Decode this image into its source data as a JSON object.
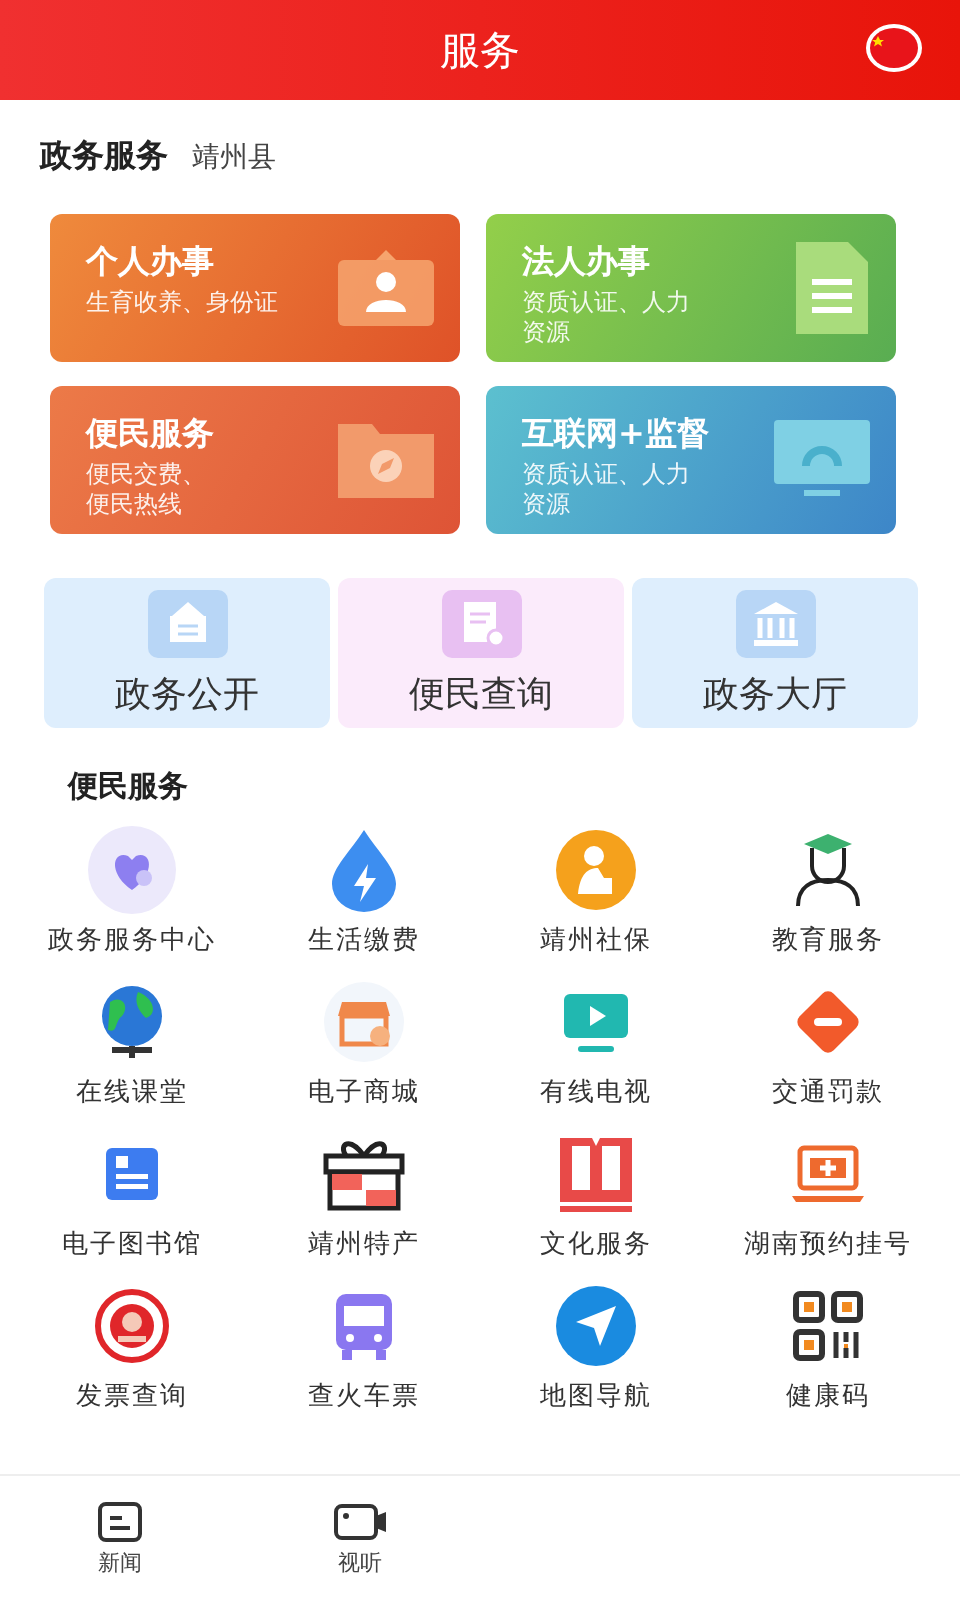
{
  "header": {
    "title": "服务"
  },
  "region": {
    "title": "政务服务",
    "county": "靖州县"
  },
  "cards": [
    {
      "kind": "person",
      "title": "个人办事",
      "subtitle": "生育收养、身份证"
    },
    {
      "kind": "legal",
      "title": "法人办事",
      "subtitle": "资质认证、人力资源"
    },
    {
      "kind": "service",
      "title": "便民服务",
      "subtitle": "便民交费、便民热线"
    },
    {
      "kind": "internet",
      "title": "互联网+监督",
      "subtitle": "资质认证、人力资源"
    }
  ],
  "tiles": [
    {
      "kind": "open",
      "label": "政务公开"
    },
    {
      "kind": "query",
      "label": "便民查询"
    },
    {
      "kind": "hall",
      "label": "政务大厅"
    }
  ],
  "services": {
    "title": "便民服务",
    "items": [
      {
        "kind": "center",
        "label": "政务服务中心"
      },
      {
        "kind": "bill",
        "label": "生活缴费"
      },
      {
        "kind": "social",
        "label": "靖州社保"
      },
      {
        "kind": "edu",
        "label": "教育服务"
      },
      {
        "kind": "globe",
        "label": "在线课堂"
      },
      {
        "kind": "shop",
        "label": "电子商城"
      },
      {
        "kind": "tv",
        "label": "有线电视"
      },
      {
        "kind": "fine",
        "label": "交通罚款"
      },
      {
        "kind": "library",
        "label": "电子图书馆"
      },
      {
        "kind": "gift",
        "label": "靖州特产"
      },
      {
        "kind": "book",
        "label": "文化服务"
      },
      {
        "kind": "hospital",
        "label": "湖南预约挂号"
      },
      {
        "kind": "emblem",
        "label": "发票查询"
      },
      {
        "kind": "bus",
        "label": "查火车票"
      },
      {
        "kind": "nav",
        "label": "地图导航"
      },
      {
        "kind": "qr",
        "label": "健康码"
      }
    ]
  },
  "tabbar": [
    {
      "kind": "news",
      "label": "新闻",
      "selected": false
    },
    {
      "kind": "video",
      "label": "视听",
      "selected": false
    }
  ]
}
